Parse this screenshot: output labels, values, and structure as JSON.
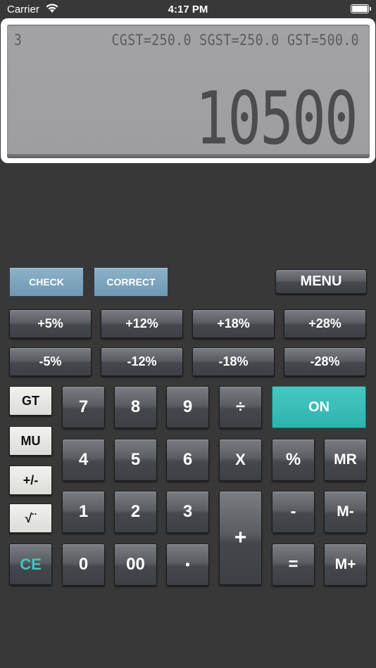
{
  "status_bar": {
    "carrier": "Carrier",
    "time": "4:17 PM"
  },
  "display": {
    "count": "3",
    "tax_line": "CGST=250.0 SGST=250.0 GST=500.0",
    "value": "10500"
  },
  "top_row": {
    "check": "CHECK",
    "correct": "CORRECT",
    "menu": "MENU"
  },
  "tax_plus": [
    "+5%",
    "+12%",
    "+18%",
    "+28%"
  ],
  "tax_minus": [
    "-5%",
    "-12%",
    "-18%",
    "-28%"
  ],
  "side_keys": [
    "GT",
    "MU",
    "+/-",
    "√¨",
    "CE"
  ],
  "keys": {
    "k7": "7",
    "k8": "8",
    "k9": "9",
    "divide": "÷",
    "on": "ON",
    "k4": "4",
    "k5": "5",
    "k6": "6",
    "multiply": "X",
    "percent": "%",
    "mr": "MR",
    "k1": "1",
    "k2": "2",
    "k3": "3",
    "plus": "+",
    "minus": "-",
    "m_minus": "M-",
    "k0": "0",
    "k00": "00",
    "dot": "•",
    "equals": "=",
    "m_plus": "M+"
  },
  "colors": {
    "background": "#383838",
    "lcd": "#a1a1a4",
    "accent_teal": "#3cc0bb",
    "blue_button": "#7ea6bf"
  }
}
